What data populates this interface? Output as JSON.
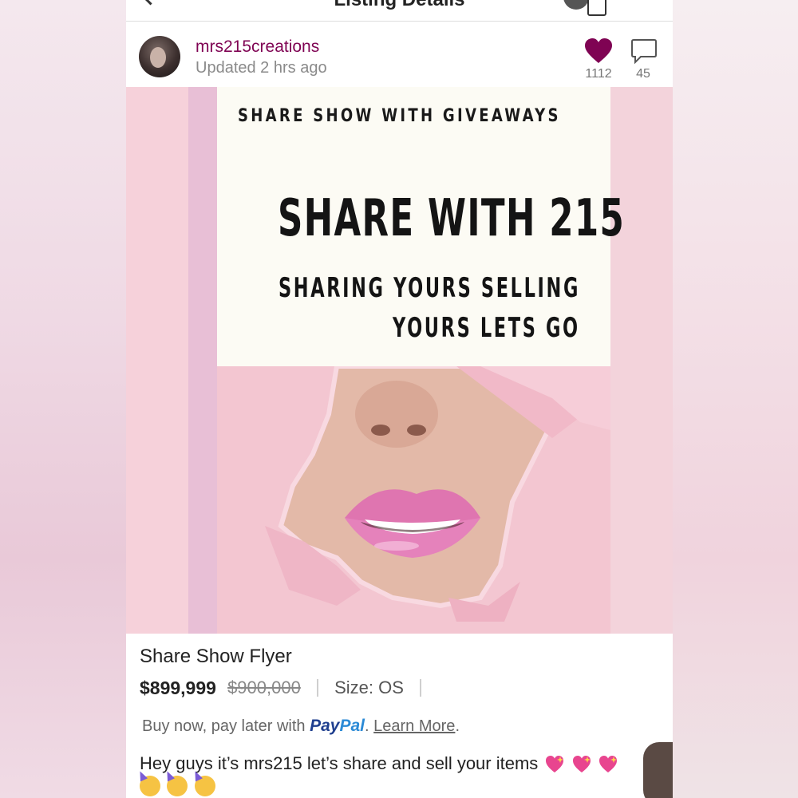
{
  "nav": {
    "title": "Listing Details"
  },
  "seller": {
    "username": "mrs215creations",
    "updated": "Updated 2 hrs ago"
  },
  "stats": {
    "likes": "1112",
    "comments": "45"
  },
  "flyer": {
    "top_text": "SHARE SHOW WITH GIVEAWAYS",
    "headline": "SHARE WITH 215",
    "sub_line1": "SHARING YOURS SELLING",
    "sub_line2": "YOURS LETS GO"
  },
  "listing": {
    "title": "Share Show Flyer",
    "price": "$899,999",
    "original_price": "$900,000",
    "size": "Size: OS"
  },
  "paypal": {
    "prefix": "Buy now, pay later with",
    "brand_pay": "Pay",
    "brand_pal": "Pal",
    "link": "Learn More",
    "suffix": "."
  },
  "description": {
    "text": "Hey guys it’s mrs215 let’s share and sell your items"
  },
  "icons": {
    "heart": "heart-icon",
    "comment": "comment-icon",
    "back": "chevron-left-icon",
    "bag": "shopping-bag-icon",
    "sparkle_heart_emoji": "sparkling-heart-emoji",
    "party_face_emoji": "partying-face-emoji"
  },
  "colors": {
    "brand": "#7f0353",
    "paypal_dark": "#1f3f8f",
    "paypal_light": "#2b8ad6"
  }
}
